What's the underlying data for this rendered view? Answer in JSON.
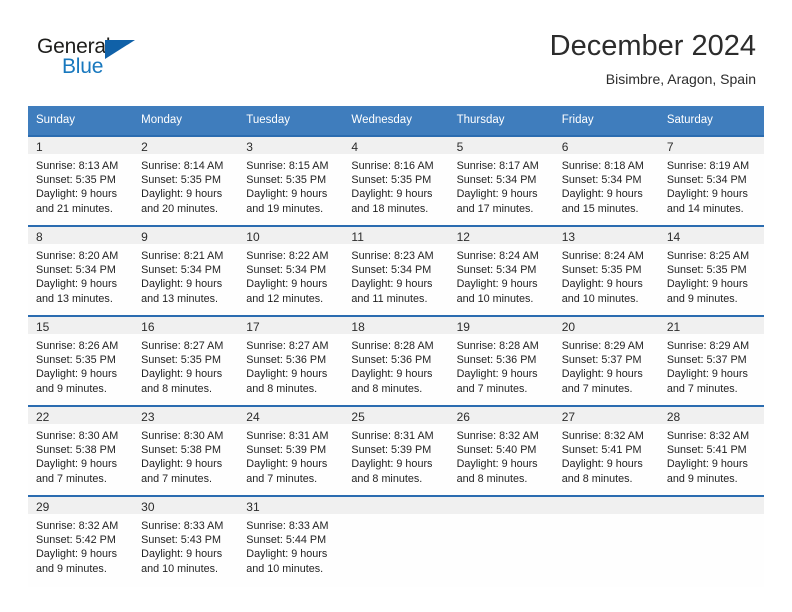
{
  "brand": {
    "line1": "General",
    "line2": "Blue",
    "accent_dark": "#1d1d1b",
    "accent_blue": "#1878be",
    "triangle_color": "#1061a8"
  },
  "header": {
    "title": "December 2024",
    "location": "Bisimbre, Aragon, Spain"
  },
  "theme": {
    "header_row_bg": "#3f7dbd",
    "daynum_bg": "#f0f0f0",
    "week_rule": "#2b6cb0",
    "text": "#1f1f1f"
  },
  "weekdays": [
    "Sunday",
    "Monday",
    "Tuesday",
    "Wednesday",
    "Thursday",
    "Friday",
    "Saturday"
  ],
  "weeks": [
    [
      {
        "day": "1",
        "sunrise": "Sunrise: 8:13 AM",
        "sunset": "Sunset: 5:35 PM",
        "daylight1": "Daylight: 9 hours",
        "daylight2": "and 21 minutes."
      },
      {
        "day": "2",
        "sunrise": "Sunrise: 8:14 AM",
        "sunset": "Sunset: 5:35 PM",
        "daylight1": "Daylight: 9 hours",
        "daylight2": "and 20 minutes."
      },
      {
        "day": "3",
        "sunrise": "Sunrise: 8:15 AM",
        "sunset": "Sunset: 5:35 PM",
        "daylight1": "Daylight: 9 hours",
        "daylight2": "and 19 minutes."
      },
      {
        "day": "4",
        "sunrise": "Sunrise: 8:16 AM",
        "sunset": "Sunset: 5:35 PM",
        "daylight1": "Daylight: 9 hours",
        "daylight2": "and 18 minutes."
      },
      {
        "day": "5",
        "sunrise": "Sunrise: 8:17 AM",
        "sunset": "Sunset: 5:34 PM",
        "daylight1": "Daylight: 9 hours",
        "daylight2": "and 17 minutes."
      },
      {
        "day": "6",
        "sunrise": "Sunrise: 8:18 AM",
        "sunset": "Sunset: 5:34 PM",
        "daylight1": "Daylight: 9 hours",
        "daylight2": "and 15 minutes."
      },
      {
        "day": "7",
        "sunrise": "Sunrise: 8:19 AM",
        "sunset": "Sunset: 5:34 PM",
        "daylight1": "Daylight: 9 hours",
        "daylight2": "and 14 minutes."
      }
    ],
    [
      {
        "day": "8",
        "sunrise": "Sunrise: 8:20 AM",
        "sunset": "Sunset: 5:34 PM",
        "daylight1": "Daylight: 9 hours",
        "daylight2": "and 13 minutes."
      },
      {
        "day": "9",
        "sunrise": "Sunrise: 8:21 AM",
        "sunset": "Sunset: 5:34 PM",
        "daylight1": "Daylight: 9 hours",
        "daylight2": "and 13 minutes."
      },
      {
        "day": "10",
        "sunrise": "Sunrise: 8:22 AM",
        "sunset": "Sunset: 5:34 PM",
        "daylight1": "Daylight: 9 hours",
        "daylight2": "and 12 minutes."
      },
      {
        "day": "11",
        "sunrise": "Sunrise: 8:23 AM",
        "sunset": "Sunset: 5:34 PM",
        "daylight1": "Daylight: 9 hours",
        "daylight2": "and 11 minutes."
      },
      {
        "day": "12",
        "sunrise": "Sunrise: 8:24 AM",
        "sunset": "Sunset: 5:34 PM",
        "daylight1": "Daylight: 9 hours",
        "daylight2": "and 10 minutes."
      },
      {
        "day": "13",
        "sunrise": "Sunrise: 8:24 AM",
        "sunset": "Sunset: 5:35 PM",
        "daylight1": "Daylight: 9 hours",
        "daylight2": "and 10 minutes."
      },
      {
        "day": "14",
        "sunrise": "Sunrise: 8:25 AM",
        "sunset": "Sunset: 5:35 PM",
        "daylight1": "Daylight: 9 hours",
        "daylight2": "and 9 minutes."
      }
    ],
    [
      {
        "day": "15",
        "sunrise": "Sunrise: 8:26 AM",
        "sunset": "Sunset: 5:35 PM",
        "daylight1": "Daylight: 9 hours",
        "daylight2": "and 9 minutes."
      },
      {
        "day": "16",
        "sunrise": "Sunrise: 8:27 AM",
        "sunset": "Sunset: 5:35 PM",
        "daylight1": "Daylight: 9 hours",
        "daylight2": "and 8 minutes."
      },
      {
        "day": "17",
        "sunrise": "Sunrise: 8:27 AM",
        "sunset": "Sunset: 5:36 PM",
        "daylight1": "Daylight: 9 hours",
        "daylight2": "and 8 minutes."
      },
      {
        "day": "18",
        "sunrise": "Sunrise: 8:28 AM",
        "sunset": "Sunset: 5:36 PM",
        "daylight1": "Daylight: 9 hours",
        "daylight2": "and 8 minutes."
      },
      {
        "day": "19",
        "sunrise": "Sunrise: 8:28 AM",
        "sunset": "Sunset: 5:36 PM",
        "daylight1": "Daylight: 9 hours",
        "daylight2": "and 7 minutes."
      },
      {
        "day": "20",
        "sunrise": "Sunrise: 8:29 AM",
        "sunset": "Sunset: 5:37 PM",
        "daylight1": "Daylight: 9 hours",
        "daylight2": "and 7 minutes."
      },
      {
        "day": "21",
        "sunrise": "Sunrise: 8:29 AM",
        "sunset": "Sunset: 5:37 PM",
        "daylight1": "Daylight: 9 hours",
        "daylight2": "and 7 minutes."
      }
    ],
    [
      {
        "day": "22",
        "sunrise": "Sunrise: 8:30 AM",
        "sunset": "Sunset: 5:38 PM",
        "daylight1": "Daylight: 9 hours",
        "daylight2": "and 7 minutes."
      },
      {
        "day": "23",
        "sunrise": "Sunrise: 8:30 AM",
        "sunset": "Sunset: 5:38 PM",
        "daylight1": "Daylight: 9 hours",
        "daylight2": "and 7 minutes."
      },
      {
        "day": "24",
        "sunrise": "Sunrise: 8:31 AM",
        "sunset": "Sunset: 5:39 PM",
        "daylight1": "Daylight: 9 hours",
        "daylight2": "and 7 minutes."
      },
      {
        "day": "25",
        "sunrise": "Sunrise: 8:31 AM",
        "sunset": "Sunset: 5:39 PM",
        "daylight1": "Daylight: 9 hours",
        "daylight2": "and 8 minutes."
      },
      {
        "day": "26",
        "sunrise": "Sunrise: 8:32 AM",
        "sunset": "Sunset: 5:40 PM",
        "daylight1": "Daylight: 9 hours",
        "daylight2": "and 8 minutes."
      },
      {
        "day": "27",
        "sunrise": "Sunrise: 8:32 AM",
        "sunset": "Sunset: 5:41 PM",
        "daylight1": "Daylight: 9 hours",
        "daylight2": "and 8 minutes."
      },
      {
        "day": "28",
        "sunrise": "Sunrise: 8:32 AM",
        "sunset": "Sunset: 5:41 PM",
        "daylight1": "Daylight: 9 hours",
        "daylight2": "and 9 minutes."
      }
    ],
    [
      {
        "day": "29",
        "sunrise": "Sunrise: 8:32 AM",
        "sunset": "Sunset: 5:42 PM",
        "daylight1": "Daylight: 9 hours",
        "daylight2": "and 9 minutes."
      },
      {
        "day": "30",
        "sunrise": "Sunrise: 8:33 AM",
        "sunset": "Sunset: 5:43 PM",
        "daylight1": "Daylight: 9 hours",
        "daylight2": "and 10 minutes."
      },
      {
        "day": "31",
        "sunrise": "Sunrise: 8:33 AM",
        "sunset": "Sunset: 5:44 PM",
        "daylight1": "Daylight: 9 hours",
        "daylight2": "and 10 minutes."
      },
      {
        "day": "",
        "sunrise": "",
        "sunset": "",
        "daylight1": "",
        "daylight2": ""
      },
      {
        "day": "",
        "sunrise": "",
        "sunset": "",
        "daylight1": "",
        "daylight2": ""
      },
      {
        "day": "",
        "sunrise": "",
        "sunset": "",
        "daylight1": "",
        "daylight2": ""
      },
      {
        "day": "",
        "sunrise": "",
        "sunset": "",
        "daylight1": "",
        "daylight2": ""
      }
    ]
  ]
}
